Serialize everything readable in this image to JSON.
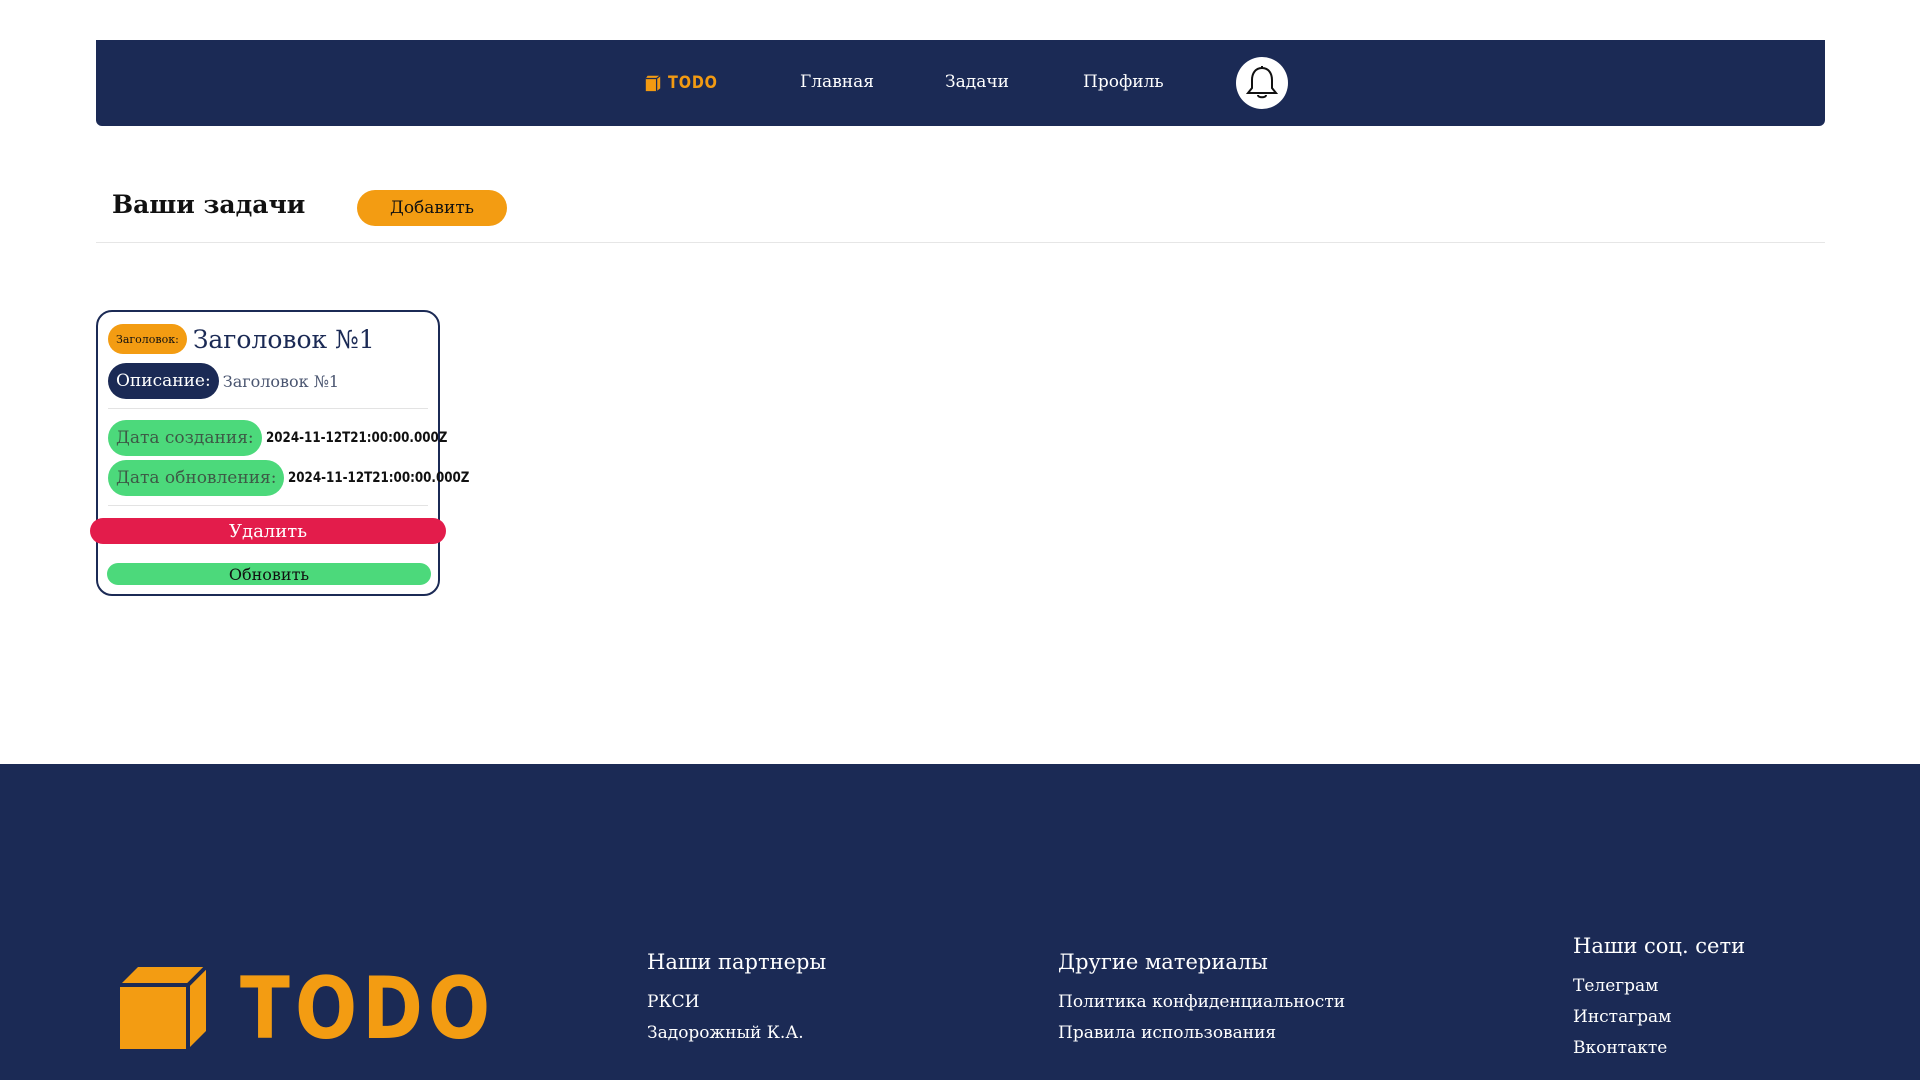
{
  "colors": {
    "navy": "#1b2a55",
    "orange": "#f39c12",
    "green": "#4cd97b",
    "red": "#e31c4b"
  },
  "header": {
    "logo_text": "TODO",
    "nav": [
      "Главная",
      "Задачи",
      "Профиль"
    ],
    "bell_icon": "bell-icon"
  },
  "page": {
    "title": "Ваши задачи",
    "add_label": "Добавить"
  },
  "task": {
    "title_label": "Заголовок:",
    "title": "Заголовок №1",
    "desc_label": "Описание:",
    "desc": "Заголовок №1",
    "created_label": "Дата создания:",
    "created": "2024-11-12T21:00:00.000Z",
    "updated_label": "Дата обновления:",
    "updated": "2024-11-12T21:00:00.000Z",
    "delete_label": "Удалить",
    "update_label": "Обновить"
  },
  "footer": {
    "logo_text": "TODO",
    "partners": {
      "heading": "Наши партнеры",
      "links": [
        "РКСИ",
        "Задорожный К.А."
      ]
    },
    "materials": {
      "heading": "Другие материалы",
      "links": [
        "Политика конфиденциальности",
        "Правила использования"
      ]
    },
    "social": {
      "heading": "Наши соц. сети",
      "links": [
        "Телеграм",
        "Инстаграм",
        "Вконтакте"
      ]
    }
  }
}
